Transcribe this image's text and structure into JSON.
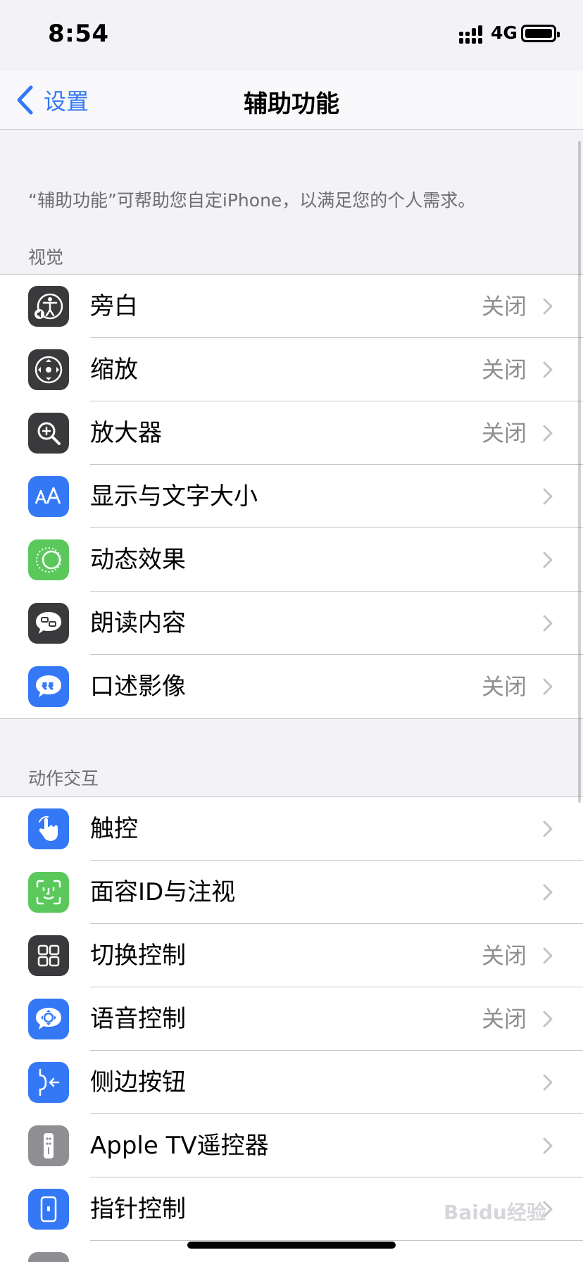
{
  "status": {
    "time": "8:54",
    "network": "4G"
  },
  "nav": {
    "back_label": "设置",
    "title": "辅助功能"
  },
  "intro": "“辅助功能”可帮助您自定iPhone，以满足您的个人需求。",
  "sections": [
    {
      "header": "视觉",
      "items": [
        {
          "label": "旁白",
          "value": "关闭",
          "icon": "voiceover-icon"
        },
        {
          "label": "缩放",
          "value": "关闭",
          "icon": "zoom-icon"
        },
        {
          "label": "放大器",
          "value": "关闭",
          "icon": "magnifier-icon"
        },
        {
          "label": "显示与文字大小",
          "value": "",
          "icon": "text-size-icon"
        },
        {
          "label": "动态效果",
          "value": "",
          "icon": "motion-icon"
        },
        {
          "label": "朗读内容",
          "value": "",
          "icon": "spoken-content-icon"
        },
        {
          "label": "口述影像",
          "value": "关闭",
          "icon": "audio-description-icon"
        }
      ]
    },
    {
      "header": "动作交互",
      "items": [
        {
          "label": "触控",
          "value": "",
          "icon": "touch-icon"
        },
        {
          "label": "面容ID与注视",
          "value": "",
          "icon": "face-id-icon"
        },
        {
          "label": "切换控制",
          "value": "关闭",
          "icon": "switch-control-icon"
        },
        {
          "label": "语音控制",
          "value": "关闭",
          "icon": "voice-control-icon"
        },
        {
          "label": "侧边按钮",
          "value": "",
          "icon": "side-button-icon"
        },
        {
          "label": "Apple TV遥控器",
          "value": "",
          "icon": "apple-tv-remote-icon"
        },
        {
          "label": "指针控制",
          "value": "",
          "icon": "pointer-control-icon"
        }
      ]
    }
  ],
  "watermark": "Baidu经验"
}
